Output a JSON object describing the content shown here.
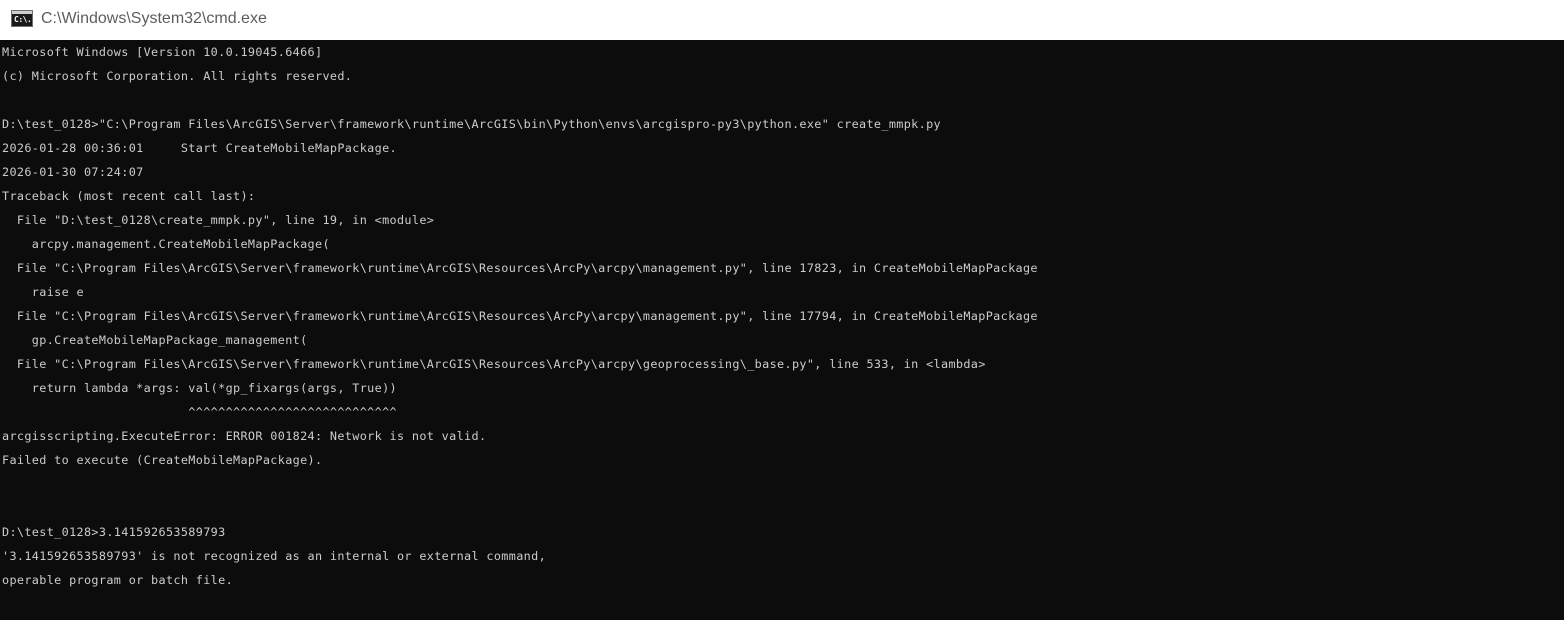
{
  "window": {
    "title": "C:\\Windows\\System32\\cmd.exe",
    "icon_name": "cmd-icon",
    "icon_glyph": "C:\\."
  },
  "console": {
    "lines": [
      "Microsoft Windows [Version 10.0.19045.6466]",
      "(c) Microsoft Corporation. All rights reserved.",
      "",
      "D:\\test_0128>\"C:\\Program Files\\ArcGIS\\Server\\framework\\runtime\\ArcGIS\\bin\\Python\\envs\\arcgispro-py3\\python.exe\" create_mmpk.py",
      "2026-01-28 00:36:01     Start CreateMobileMapPackage.",
      "2026-01-30 07:24:07",
      "Traceback (most recent call last):",
      "  File \"D:\\test_0128\\create_mmpk.py\", line 19, in <module>",
      "    arcpy.management.CreateMobileMapPackage(",
      "  File \"C:\\Program Files\\ArcGIS\\Server\\framework\\runtime\\ArcGIS\\Resources\\ArcPy\\arcpy\\management.py\", line 17823, in CreateMobileMapPackage",
      "    raise e",
      "  File \"C:\\Program Files\\ArcGIS\\Server\\framework\\runtime\\ArcGIS\\Resources\\ArcPy\\arcpy\\management.py\", line 17794, in CreateMobileMapPackage",
      "    gp.CreateMobileMapPackage_management(",
      "  File \"C:\\Program Files\\ArcGIS\\Server\\framework\\runtime\\ArcGIS\\Resources\\ArcPy\\arcpy\\geoprocessing\\_base.py\", line 533, in <lambda>",
      "    return lambda *args: val(*gp_fixargs(args, True))",
      "                         ^^^^^^^^^^^^^^^^^^^^^^^^^^^^",
      "arcgisscripting.ExecuteError: ERROR 001824: Network is not valid.",
      "Failed to execute (CreateMobileMapPackage).",
      "",
      "",
      "D:\\test_0128>3.141592653589793",
      "'3.141592653589793' is not recognized as an internal or external command,",
      "operable program or batch file."
    ]
  },
  "colors": {
    "console_background": "#0c0c0c",
    "console_text": "#cccccc",
    "titlebar_background": "#ffffff",
    "title_text": "#5d5d5d"
  }
}
